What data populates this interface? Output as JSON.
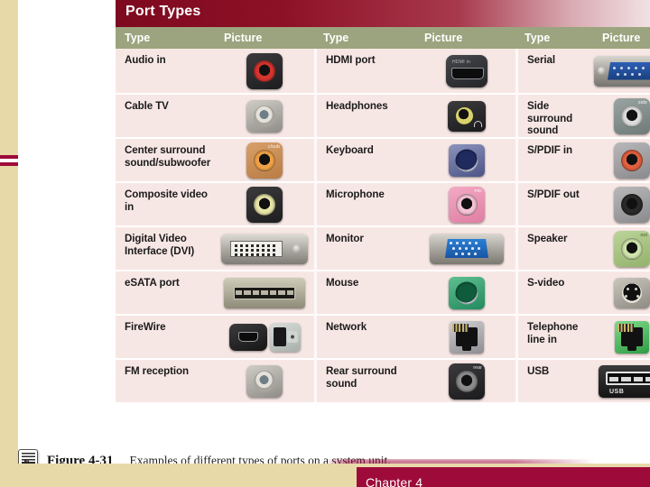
{
  "slide": {
    "figure_title": "Port Types",
    "caption_number": "Figure 4-31",
    "caption_text": "Examples of different types of ports on a system unit.",
    "footer_chapter": "Chapter 4",
    "caption_icon": "document-return-icon",
    "colors": {
      "title_bar": "#7d0a20",
      "column_header": "#9ba47e",
      "row_background": "#f7e7e4",
      "sidebar": "#e8d9a8",
      "footer_bar": "#9e0b3a"
    }
  },
  "table": {
    "headers": [
      "Type",
      "Picture",
      "Type",
      "Picture",
      "Type",
      "Picture"
    ],
    "rows": [
      {
        "col1": {
          "type": "Audio in",
          "picture": "audio-in-jack-icon"
        },
        "col2": {
          "type": "HDMI port",
          "picture": "hdmi-port-icon"
        },
        "col3": {
          "type": "Serial",
          "picture": "serial-db9-port-icon"
        }
      },
      {
        "col1": {
          "type": "Cable TV",
          "picture": "cable-tv-coax-icon"
        },
        "col2": {
          "type": "Headphones",
          "picture": "headphones-jack-icon"
        },
        "col3": {
          "type": "Side surround sound",
          "picture": "side-surround-jack-icon"
        }
      },
      {
        "col1": {
          "type": "Center surround sound/subwoofer",
          "picture": "center-subwoofer-jack-icon"
        },
        "col2": {
          "type": "Keyboard",
          "picture": "ps2-keyboard-port-icon"
        },
        "col3": {
          "type": "S/PDIF in",
          "picture": "spdif-in-jack-icon"
        }
      },
      {
        "col1": {
          "type": "Composite video in",
          "picture": "composite-video-jack-icon"
        },
        "col2": {
          "type": "Microphone",
          "picture": "microphone-jack-icon"
        },
        "col3": {
          "type": "S/PDIF out",
          "picture": "spdif-out-jack-icon"
        }
      },
      {
        "col1": {
          "type": "Digital Video Interface (DVI)",
          "picture": "dvi-port-icon"
        },
        "col2": {
          "type": "Monitor",
          "picture": "vga-monitor-port-icon"
        },
        "col3": {
          "type": "Speaker",
          "picture": "speaker-out-jack-icon"
        }
      },
      {
        "col1": {
          "type": "eSATA port",
          "picture": "esata-port-icon"
        },
        "col2": {
          "type": "Mouse",
          "picture": "ps2-mouse-port-icon"
        },
        "col3": {
          "type": "S-video",
          "picture": "s-video-port-icon"
        }
      },
      {
        "col1": {
          "type": "FireWire",
          "picture": "firewire-port-icon"
        },
        "col2": {
          "type": "Network",
          "picture": "rj45-network-port-icon"
        },
        "col3": {
          "type": "Telephone line in",
          "picture": "rj11-telephone-port-icon"
        }
      },
      {
        "col1": {
          "type": "FM reception",
          "picture": "fm-antenna-coax-icon"
        },
        "col2": {
          "type": "Rear surround sound",
          "picture": "rear-surround-jack-icon"
        },
        "col3": {
          "type": "USB",
          "picture": "usb-port-icon"
        }
      }
    ],
    "port_labels": {
      "hdmi": "HDMI in",
      "center_sub": "c/sub",
      "side": "side",
      "mic": "mic",
      "speaker": "out",
      "rear": "rear",
      "usb": "USB"
    }
  }
}
